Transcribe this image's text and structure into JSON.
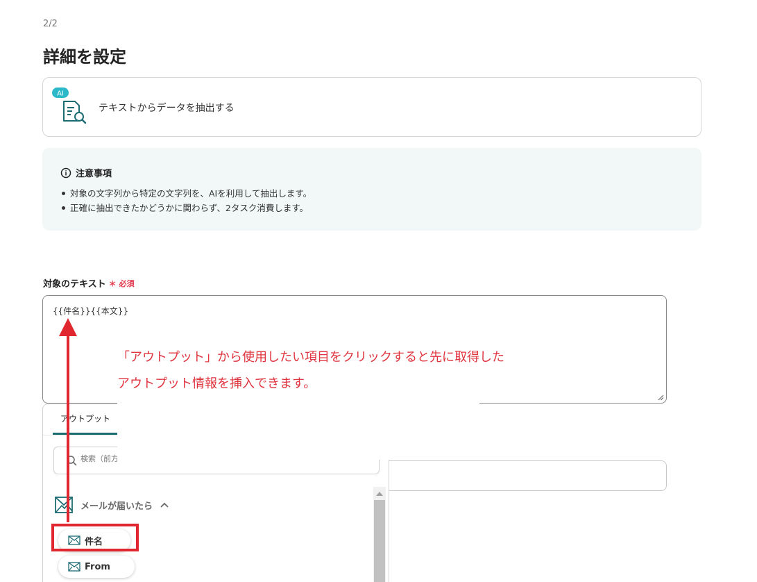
{
  "header": {
    "step": "2/2",
    "title": "詳細を設定"
  },
  "action": {
    "badge": "AI",
    "label": "テキストからデータを抽出する",
    "icon": "document-search-icon"
  },
  "notice": {
    "title": "注意事項",
    "items": [
      "対象の文字列から特定の文字列を、AIを利用して抽出します。",
      "正確に抽出できたかどうかに関わらず、2タスク消費します。"
    ]
  },
  "field": {
    "label": "対象のテキスト",
    "required_mark": "＊",
    "required_text": "必須",
    "value": "{{件名}}{{本文}}"
  },
  "picker": {
    "tab_label": "アウトプット",
    "search_placeholder": "検索（前方",
    "group_name": "メールが届いたら",
    "items": [
      "件名",
      "From"
    ]
  },
  "annotation": {
    "line1": "「アウトプット」から使用したい項目をクリックすると先に取得した",
    "line2": "アウトプット情報を挿入できます。"
  },
  "colors": {
    "accent": "#1b6b73",
    "annotation_red": "#e0343f",
    "notice_bg": "#f2f8f8",
    "ai_badge": "#2bb8c9"
  }
}
